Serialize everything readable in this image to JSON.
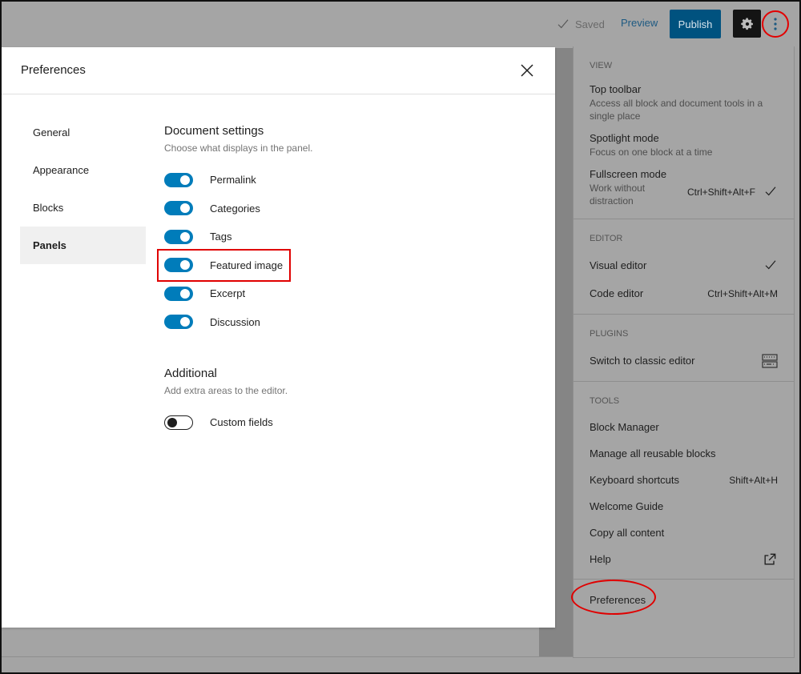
{
  "topbar": {
    "saved_label": "Saved",
    "preview_label": "Preview",
    "publish_label": "Publish",
    "settings_icon": "gear-icon",
    "more_icon": "more-vertical-icon"
  },
  "modal": {
    "title": "Preferences",
    "close_icon": "close-icon",
    "nav": [
      {
        "label": "General",
        "active": false
      },
      {
        "label": "Appearance",
        "active": false
      },
      {
        "label": "Blocks",
        "active": false
      },
      {
        "label": "Panels",
        "active": true
      }
    ],
    "document_settings": {
      "title": "Document settings",
      "description": "Choose what displays in the panel.",
      "toggles": [
        {
          "label": "Permalink",
          "on": true
        },
        {
          "label": "Categories",
          "on": true
        },
        {
          "label": "Tags",
          "on": true
        },
        {
          "label": "Featured image",
          "on": true,
          "highlighted": true
        },
        {
          "label": "Excerpt",
          "on": true
        },
        {
          "label": "Discussion",
          "on": true
        }
      ]
    },
    "additional": {
      "title": "Additional",
      "description": "Add extra areas to the editor.",
      "toggles": [
        {
          "label": "Custom fields",
          "on": false
        }
      ]
    }
  },
  "menu": {
    "view": {
      "label": "View",
      "items": [
        {
          "label": "Top toolbar",
          "description": "Access all block and document tools in a single place"
        },
        {
          "label": "Spotlight mode",
          "description": "Focus on one block at a time"
        },
        {
          "label": "Fullscreen mode",
          "description": "Work without distraction",
          "shortcut": "Ctrl+Shift+Alt+F",
          "checked": true
        }
      ]
    },
    "editor": {
      "label": "Editor",
      "items": [
        {
          "label": "Visual editor",
          "checked": true
        },
        {
          "label": "Code editor",
          "shortcut": "Ctrl+Shift+Alt+M"
        }
      ]
    },
    "plugins": {
      "label": "Plugins",
      "items": [
        {
          "label": "Switch to classic editor",
          "icon": "keyboard-icon"
        }
      ]
    },
    "tools": {
      "label": "Tools",
      "items": [
        {
          "label": "Block Manager"
        },
        {
          "label": "Manage all reusable blocks"
        },
        {
          "label": "Keyboard shortcuts",
          "shortcut": "Shift+Alt+H"
        },
        {
          "label": "Welcome Guide"
        },
        {
          "label": "Copy all content"
        },
        {
          "label": "Help",
          "icon": "external-link-icon"
        }
      ]
    },
    "preferences": {
      "label": "Preferences"
    }
  }
}
